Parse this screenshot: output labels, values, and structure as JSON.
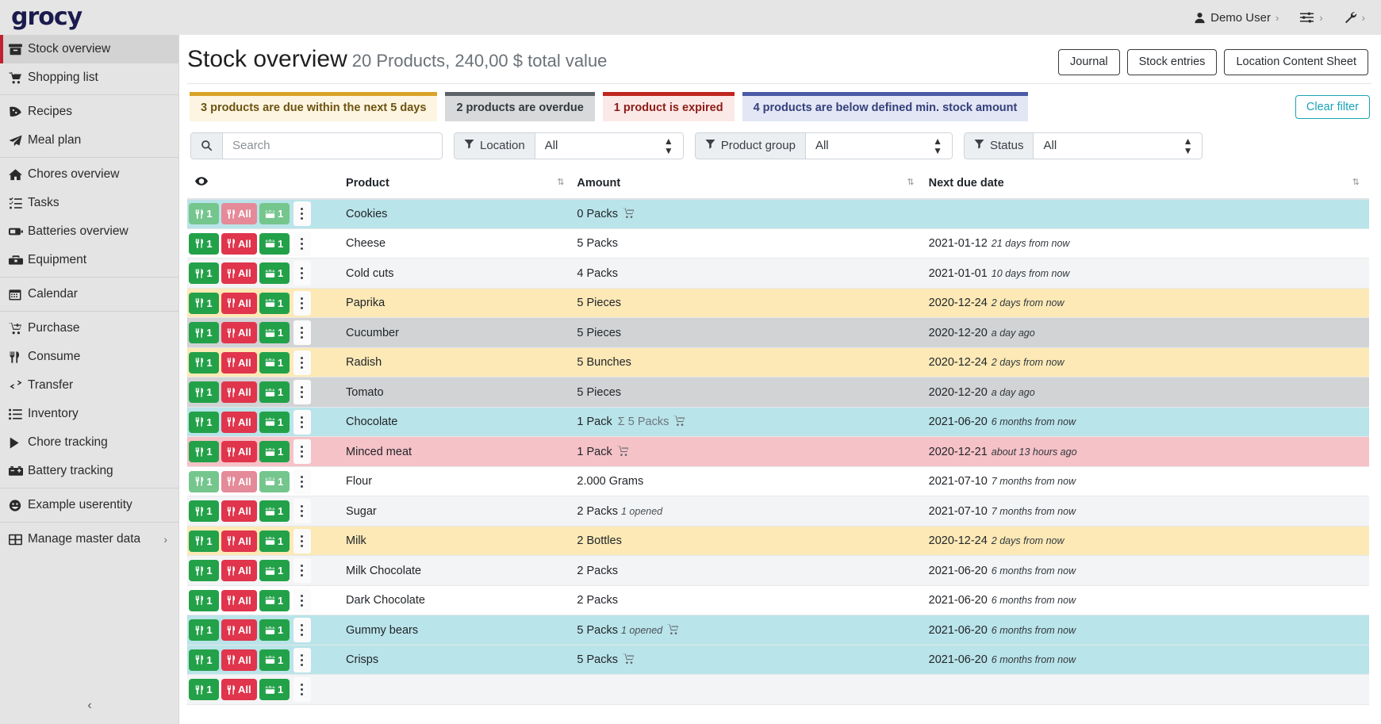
{
  "app": {
    "brand": "grocy"
  },
  "topbar": {
    "user": "Demo User",
    "user_caret": "›",
    "settings_caret": "›",
    "tools_caret": "›",
    "icons": {
      "user": "user-icon",
      "sliders": "sliders-icon",
      "wrench": "wrench-icon"
    }
  },
  "sidebar": {
    "items": [
      {
        "label": "Stock overview",
        "icon": "archive-box-icon",
        "active": true,
        "sep_after": false
      },
      {
        "label": "Shopping list",
        "icon": "shopping-cart-icon",
        "active": false,
        "sep_after": true
      },
      {
        "label": "Recipes",
        "icon": "pizza-slice-icon",
        "active": false,
        "sep_after": false
      },
      {
        "label": "Meal plan",
        "icon": "paper-plane-icon",
        "active": false,
        "sep_after": true
      },
      {
        "label": "Chores overview",
        "icon": "home-icon",
        "active": false,
        "sep_after": false
      },
      {
        "label": "Tasks",
        "icon": "task-list-icon",
        "active": false,
        "sep_after": false
      },
      {
        "label": "Batteries overview",
        "icon": "battery-icon",
        "active": false,
        "sep_after": false
      },
      {
        "label": "Equipment",
        "icon": "toolbox-icon",
        "active": false,
        "sep_after": true
      },
      {
        "label": "Calendar",
        "icon": "calendar-icon",
        "active": false,
        "sep_after": true
      },
      {
        "label": "Purchase",
        "icon": "cart-plus-icon",
        "active": false,
        "sep_after": false
      },
      {
        "label": "Consume",
        "icon": "utensils-icon",
        "active": false,
        "sep_after": false
      },
      {
        "label": "Transfer",
        "icon": "exchange-icon",
        "active": false,
        "sep_after": false
      },
      {
        "label": "Inventory",
        "icon": "list-icon",
        "active": false,
        "sep_after": false
      },
      {
        "label": "Chore tracking",
        "icon": "play-icon",
        "active": false,
        "sep_after": false
      },
      {
        "label": "Battery tracking",
        "icon": "car-battery-icon",
        "active": false,
        "sep_after": true
      },
      {
        "label": "Example userentity",
        "icon": "smiley-icon",
        "active": false,
        "sep_after": true
      },
      {
        "label": "Manage master data",
        "icon": "grid-icon",
        "active": false,
        "sep_after": false,
        "chevron": "›"
      }
    ],
    "collapse_icon": "chevron-left-icon"
  },
  "header": {
    "title": "Stock overview",
    "subtitle": "20 Products, 240,00 $ total value",
    "buttons": [
      {
        "label": "Journal"
      },
      {
        "label": "Stock entries"
      },
      {
        "label": "Location Content Sheet"
      }
    ]
  },
  "status_chips": [
    {
      "label": "3 products are due within the next 5 days",
      "style": "due",
      "accent": "#d9a327"
    },
    {
      "label": "2 products are overdue",
      "style": "over",
      "accent": "#5b6368"
    },
    {
      "label": "1 product is expired",
      "style": "exp",
      "accent": "#c0261f"
    },
    {
      "label": "4 products are below defined min. stock amount",
      "style": "below",
      "accent": "#4a5ba5"
    }
  ],
  "clear_filter_label": "Clear filter",
  "filters": {
    "search_placeholder": "Search",
    "location": {
      "label": "Location",
      "value": "All"
    },
    "product_group": {
      "label": "Product group",
      "value": "All"
    },
    "status": {
      "label": "Status",
      "value": "All"
    }
  },
  "table": {
    "headers": {
      "eye": "eye-icon",
      "product": "Product",
      "amount": "Amount",
      "due": "Next due date"
    },
    "button_labels": {
      "consume_one": "1",
      "consume_all": "All",
      "open_one": "1"
    },
    "rows": [
      {
        "product": "Cookies",
        "amount": "0 Packs",
        "amount_sub": "",
        "agg": "",
        "cart": true,
        "date": "",
        "rel": "",
        "rowstyle": "r-info",
        "muted": true
      },
      {
        "product": "Cheese",
        "amount": "5 Packs",
        "amount_sub": "",
        "agg": "",
        "cart": false,
        "date": "2021-01-12",
        "rel": "21 days from now",
        "rowstyle": "r-plain",
        "muted": false
      },
      {
        "product": "Cold cuts",
        "amount": "4 Packs",
        "amount_sub": "",
        "agg": "",
        "cart": false,
        "date": "2021-01-01",
        "rel": "10 days from now",
        "rowstyle": "r-alt",
        "muted": false
      },
      {
        "product": "Paprika",
        "amount": "5 Pieces",
        "amount_sub": "",
        "agg": "",
        "cart": false,
        "date": "2020-12-24",
        "rel": "2 days from now",
        "rowstyle": "r-warn",
        "muted": false
      },
      {
        "product": "Cucumber",
        "amount": "5 Pieces",
        "amount_sub": "",
        "agg": "",
        "cart": false,
        "date": "2020-12-20",
        "rel": "a day ago",
        "rowstyle": "r-secondary",
        "muted": false
      },
      {
        "product": "Radish",
        "amount": "5 Bunches",
        "amount_sub": "",
        "agg": "",
        "cart": false,
        "date": "2020-12-24",
        "rel": "2 days from now",
        "rowstyle": "r-warn",
        "muted": false
      },
      {
        "product": "Tomato",
        "amount": "5 Pieces",
        "amount_sub": "",
        "agg": "",
        "cart": false,
        "date": "2020-12-20",
        "rel": "a day ago",
        "rowstyle": "r-secondary",
        "muted": false
      },
      {
        "product": "Chocolate",
        "amount": "1 Pack",
        "amount_sub": "",
        "agg": "Σ 5 Packs",
        "cart": true,
        "date": "2021-06-20",
        "rel": "6 months from now",
        "rowstyle": "r-info",
        "muted": false
      },
      {
        "product": "Minced meat",
        "amount": "1 Pack",
        "amount_sub": "",
        "agg": "",
        "cart": true,
        "date": "2020-12-21",
        "rel": "about 13 hours ago",
        "rowstyle": "r-danger",
        "muted": false
      },
      {
        "product": "Flour",
        "amount": "2.000 Grams",
        "amount_sub": "",
        "agg": "",
        "cart": false,
        "date": "2021-07-10",
        "rel": "7 months from now",
        "rowstyle": "r-plain",
        "muted": true
      },
      {
        "product": "Sugar",
        "amount": "2 Packs",
        "amount_sub": "1 opened",
        "agg": "",
        "cart": false,
        "date": "2021-07-10",
        "rel": "7 months from now",
        "rowstyle": "r-alt",
        "muted": false
      },
      {
        "product": "Milk",
        "amount": "2 Bottles",
        "amount_sub": "",
        "agg": "",
        "cart": false,
        "date": "2020-12-24",
        "rel": "2 days from now",
        "rowstyle": "r-warn",
        "muted": false
      },
      {
        "product": "Milk Chocolate",
        "amount": "2 Packs",
        "amount_sub": "",
        "agg": "",
        "cart": false,
        "date": "2021-06-20",
        "rel": "6 months from now",
        "rowstyle": "r-alt",
        "muted": false
      },
      {
        "product": "Dark Chocolate",
        "amount": "2 Packs",
        "amount_sub": "",
        "agg": "",
        "cart": false,
        "date": "2021-06-20",
        "rel": "6 months from now",
        "rowstyle": "r-plain",
        "muted": false
      },
      {
        "product": "Gummy bears",
        "amount": "5 Packs",
        "amount_sub": "1 opened",
        "agg": "",
        "cart": true,
        "date": "2021-06-20",
        "rel": "6 months from now",
        "rowstyle": "r-info",
        "muted": false
      },
      {
        "product": "Crisps",
        "amount": "5 Packs",
        "amount_sub": "",
        "agg": "",
        "cart": true,
        "date": "2021-06-20",
        "rel": "6 months from now",
        "rowstyle": "r-info",
        "muted": false
      },
      {
        "product": "",
        "amount": "",
        "amount_sub": "",
        "agg": "",
        "cart": false,
        "date": "",
        "rel": "",
        "rowstyle": "r-alt",
        "muted": false
      }
    ]
  },
  "colors": {
    "brand": "#1b1b4d",
    "active_accent": "#c21f32",
    "green": "#23a149",
    "red": "#e0354c",
    "teal": "#1ba3b5"
  }
}
